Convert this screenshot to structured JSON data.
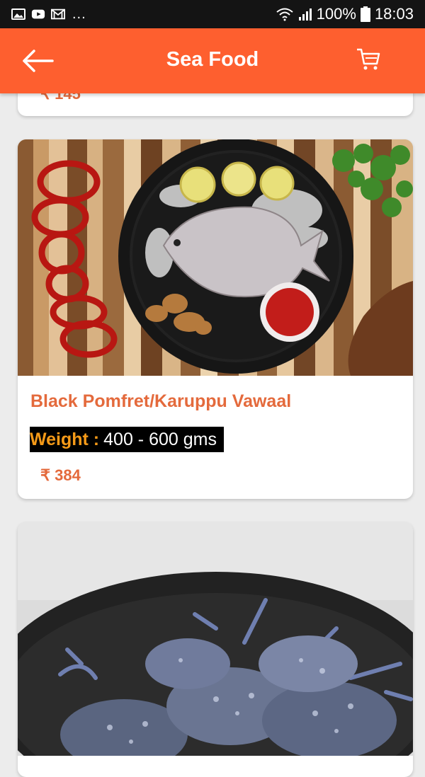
{
  "status_bar": {
    "battery": "100%",
    "time": "18:03",
    "overflow": "..."
  },
  "header": {
    "title": "Sea Food",
    "back_icon": "arrow-left-icon",
    "cart_icon": "cart-icon"
  },
  "colors": {
    "header_bg": "#fe5f2f",
    "accent_text": "#e46a3c",
    "weight_label": "#f59a18"
  },
  "prev_item": {
    "price": "₹ 145"
  },
  "products": [
    {
      "name": "Black Pomfret/Karuppu Vawaal",
      "weight_label": "Weight :",
      "weight_value": "400 - 600 gms",
      "price": "₹ 384",
      "image": "pomfret-photo"
    },
    {
      "image": "crab-photo"
    }
  ]
}
